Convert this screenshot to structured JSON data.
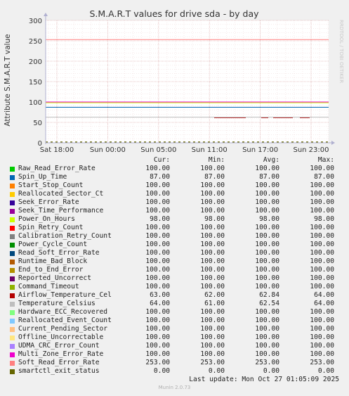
{
  "chart_data": {
    "type": "line",
    "title": "S.M.A.R.T values for drive sda - by day",
    "ylabel": "Attribute S.M.A.R.T value",
    "ylim": [
      0,
      300
    ],
    "yticks": [
      "0",
      "50",
      "100",
      "150",
      "200",
      "250",
      "300"
    ],
    "xticks": [
      "Sat 18:00",
      "Sun 00:00",
      "Sun 05:00",
      "Sun 11:00",
      "Sun 17:00",
      "Sun 23:00"
    ],
    "grid": true,
    "watermark": "RRDTOOL / TOBI OETIKER",
    "legend_headers": [
      "Cur:",
      "Min:",
      "Avg:",
      "Max:"
    ],
    "series": [
      {
        "name": "Raw_Read_Error_Rate",
        "color": "#00cc00",
        "cur": "100.00",
        "min": "100.00",
        "avg": "100.00",
        "max": "100.00",
        "level": 100
      },
      {
        "name": "Spin_Up_Time",
        "color": "#0066b3",
        "cur": "87.00",
        "min": "87.00",
        "avg": "87.00",
        "max": "87.00",
        "level": 87
      },
      {
        "name": "Start_Stop_Count",
        "color": "#ff8000",
        "cur": "100.00",
        "min": "100.00",
        "avg": "100.00",
        "max": "100.00",
        "level": 100
      },
      {
        "name": "Reallocated_Sector_Ct",
        "color": "#ffcc00",
        "cur": "100.00",
        "min": "100.00",
        "avg": "100.00",
        "max": "100.00",
        "level": 100
      },
      {
        "name": "Seek_Error_Rate",
        "color": "#330099",
        "cur": "100.00",
        "min": "100.00",
        "avg": "100.00",
        "max": "100.00",
        "level": 100
      },
      {
        "name": "Seek_Time_Performance",
        "color": "#990099",
        "cur": "100.00",
        "min": "100.00",
        "avg": "100.00",
        "max": "100.00",
        "level": 100
      },
      {
        "name": "Power_On_Hours",
        "color": "#ccff00",
        "cur": "98.00",
        "min": "98.00",
        "avg": "98.00",
        "max": "98.00",
        "level": 98
      },
      {
        "name": "Spin_Retry_Count",
        "color": "#ff0000",
        "cur": "100.00",
        "min": "100.00",
        "avg": "100.00",
        "max": "100.00",
        "level": 100
      },
      {
        "name": "Calibration_Retry_Count",
        "color": "#808080",
        "cur": "100.00",
        "min": "100.00",
        "avg": "100.00",
        "max": "100.00",
        "level": 100
      },
      {
        "name": "Power_Cycle_Count",
        "color": "#008f00",
        "cur": "100.00",
        "min": "100.00",
        "avg": "100.00",
        "max": "100.00",
        "level": 100
      },
      {
        "name": "Read_Soft_Error_Rate",
        "color": "#00487d",
        "cur": "100.00",
        "min": "100.00",
        "avg": "100.00",
        "max": "100.00",
        "level": 100
      },
      {
        "name": "Runtime_Bad_Block",
        "color": "#b35a00",
        "cur": "100.00",
        "min": "100.00",
        "avg": "100.00",
        "max": "100.00",
        "level": 100
      },
      {
        "name": "End_to_End_Error",
        "color": "#b38f00",
        "cur": "100.00",
        "min": "100.00",
        "avg": "100.00",
        "max": "100.00",
        "level": 100
      },
      {
        "name": "Reported_Uncorrect",
        "color": "#6b006b",
        "cur": "100.00",
        "min": "100.00",
        "avg": "100.00",
        "max": "100.00",
        "level": 100
      },
      {
        "name": "Command_Timeout",
        "color": "#8fb300",
        "cur": "100.00",
        "min": "100.00",
        "avg": "100.00",
        "max": "100.00",
        "level": 100
      },
      {
        "name": "Airflow_Temperature_Cel",
        "color": "#b30000",
        "cur": "63.00",
        "min": "62.00",
        "avg": "62.84",
        "max": "64.00",
        "level": 63
      },
      {
        "name": "Temperature_Celsius",
        "color": "#bebebe",
        "cur": "64.00",
        "min": "61.00",
        "avg": "62.54",
        "max": "64.00",
        "level": 63
      },
      {
        "name": "Hardware_ECC_Recovered",
        "color": "#80ff80",
        "cur": "100.00",
        "min": "100.00",
        "avg": "100.00",
        "max": "100.00",
        "level": 100
      },
      {
        "name": "Reallocated_Event_Count",
        "color": "#80c9ff",
        "cur": "100.00",
        "min": "100.00",
        "avg": "100.00",
        "max": "100.00",
        "level": 100
      },
      {
        "name": "Current_Pending_Sector",
        "color": "#ffc080",
        "cur": "100.00",
        "min": "100.00",
        "avg": "100.00",
        "max": "100.00",
        "level": 100
      },
      {
        "name": "Offline_Uncorrectable",
        "color": "#ffe680",
        "cur": "100.00",
        "min": "100.00",
        "avg": "100.00",
        "max": "100.00",
        "level": 100
      },
      {
        "name": "UDMA_CRC_Error_Count",
        "color": "#aa80ff",
        "cur": "100.00",
        "min": "100.00",
        "avg": "100.00",
        "max": "100.00",
        "level": 100
      },
      {
        "name": "Multi_Zone_Error_Rate",
        "color": "#ee00cc",
        "cur": "100.00",
        "min": "100.00",
        "avg": "100.00",
        "max": "100.00",
        "level": 100
      },
      {
        "name": "Soft_Read_Error_Rate",
        "color": "#ff8080",
        "cur": "253.00",
        "min": "253.00",
        "avg": "253.00",
        "max": "253.00",
        "level": 253
      },
      {
        "name": "smartctl_exit_status",
        "color": "#666600",
        "cur": "0.00",
        "min": "0.00",
        "avg": "0.00",
        "max": "0.00",
        "level": 0
      }
    ],
    "last_update": "Last update: Mon Oct 27 01:05:09 2025",
    "footer": "Munin 2.0.73"
  }
}
